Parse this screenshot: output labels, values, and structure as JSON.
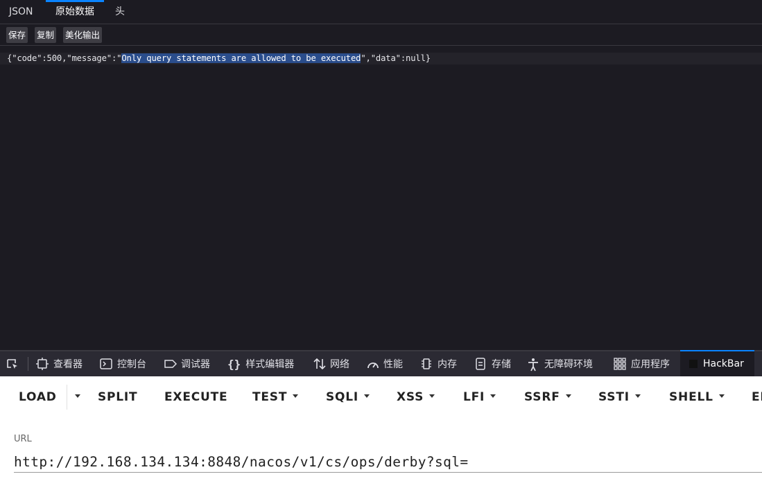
{
  "viewer": {
    "tabs": [
      "JSON",
      "原始数据",
      "头"
    ],
    "active_tab": "原始数据",
    "toolbar": {
      "save": "保存",
      "copy": "复制",
      "pretty": "美化输出"
    }
  },
  "raw": {
    "before": "{\"code\":500,\"message\":\"",
    "selected": "Only query statements are allowed to be executed",
    "after": "\",\"data\":null}"
  },
  "devtools": {
    "tabs": [
      {
        "label": "查看器",
        "icon": "inspector-icon"
      },
      {
        "label": "控制台",
        "icon": "console-icon"
      },
      {
        "label": "调试器",
        "icon": "debugger-icon"
      },
      {
        "label": "样式编辑器",
        "icon": "braces-icon"
      },
      {
        "label": "网络",
        "icon": "network-arrows-icon"
      },
      {
        "label": "性能",
        "icon": "gauge-icon"
      },
      {
        "label": "内存",
        "icon": "memory-chip-icon"
      },
      {
        "label": "存储",
        "icon": "storage-icon"
      },
      {
        "label": "无障碍环境",
        "icon": "accessibility-icon"
      },
      {
        "label": "应用程序",
        "icon": "grid-icon"
      },
      {
        "label": "HackBar",
        "icon": "hackbar-icon"
      }
    ],
    "active_tab": "HackBar",
    "accent_color": "#0a84ff"
  },
  "hackbar": {
    "menu": {
      "load": "LOAD",
      "split": "SPLIT",
      "execute": "EXECUTE",
      "test": "TEST",
      "sqli": "SQLI",
      "xss": "XSS",
      "lfi": "LFI",
      "ssrf": "SSRF",
      "ssti": "SSTI",
      "shell": "SHELL",
      "more": "EN"
    },
    "url_label": "URL",
    "url_value": "http://192.168.134.134:8848/nacos/v1/cs/ops/derby?sql="
  }
}
